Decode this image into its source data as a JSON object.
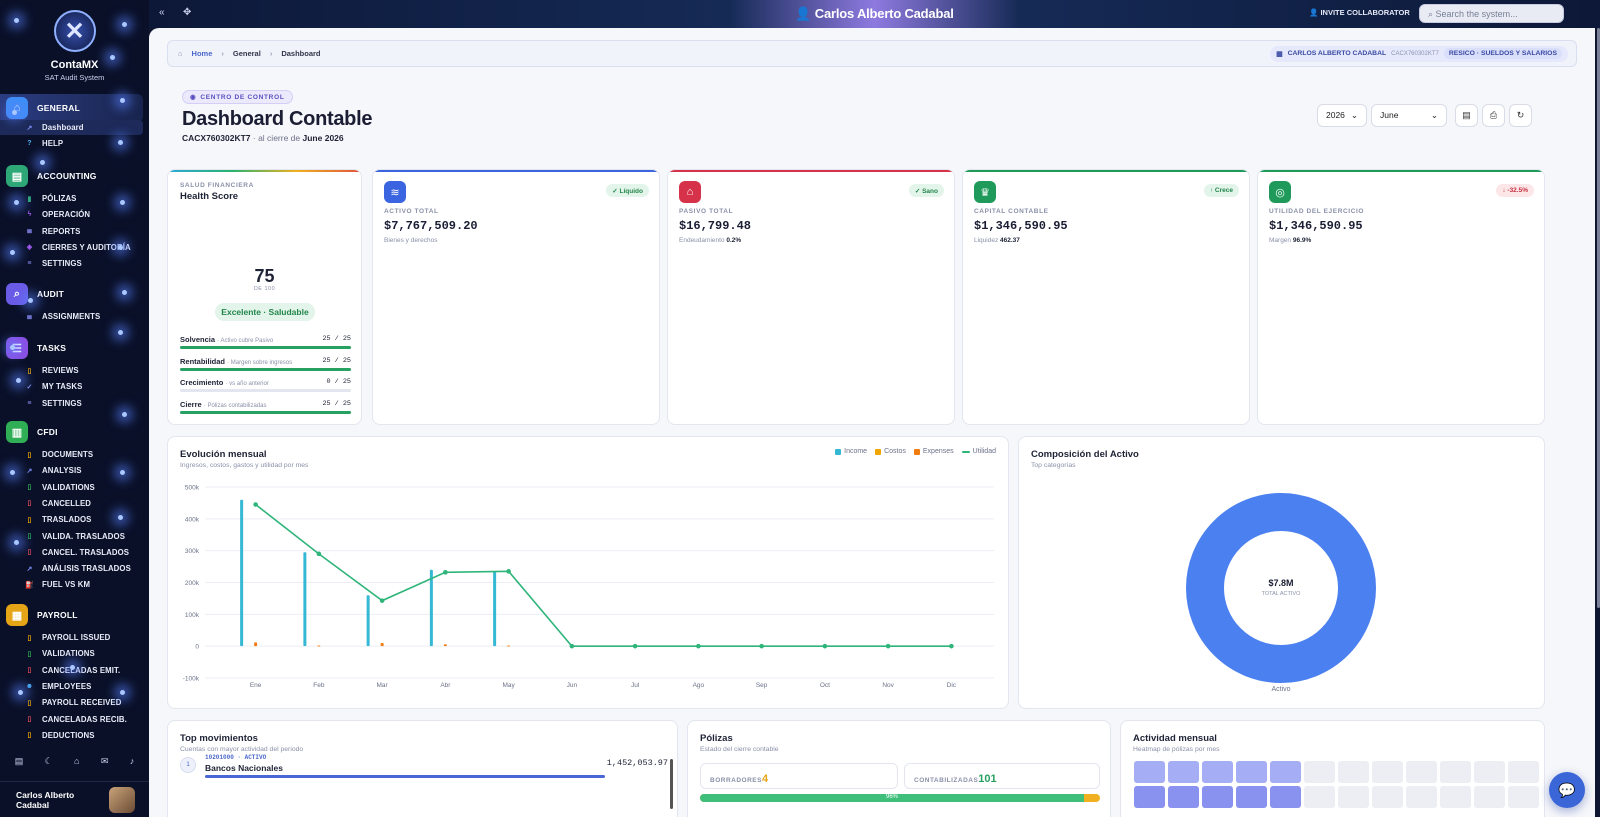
{
  "app": {
    "name": "ContaMX",
    "subtitle": "SAT Audit System",
    "user_name": "Carlos Alberto Cadabal"
  },
  "sidebar": {
    "sections": [
      {
        "label": "GENERAL",
        "icon": "home-icon",
        "color": "#3f8ef7",
        "items": [
          {
            "label": "Dashboard",
            "icon": "chart-line-icon",
            "active": true
          },
          {
            "label": "HELP",
            "icon": "question-icon"
          }
        ]
      },
      {
        "label": "ACCOUNTING",
        "icon": "ledger-icon",
        "color": "#2fa877",
        "items": [
          {
            "label": "PÓLIZAS",
            "icon": "book-icon"
          },
          {
            "label": "OPERACIÓN",
            "icon": "bolt-icon"
          },
          {
            "label": "REPORTS",
            "icon": "list-icon"
          },
          {
            "label": "CIERRES Y AUDITORÍA",
            "icon": "shield-icon"
          },
          {
            "label": "SETTINGS",
            "icon": "sliders-icon"
          }
        ]
      },
      {
        "label": "AUDIT",
        "icon": "search-icon",
        "color": "#6b5ce7",
        "items": [
          {
            "label": "ASSIGNMENTS",
            "icon": "list-icon"
          }
        ]
      },
      {
        "label": "TASKS",
        "icon": "tasks-icon",
        "color": "#8b4ee3",
        "items": [
          {
            "label": "REVIEWS",
            "icon": "doc-icon"
          },
          {
            "label": "MY TASKS",
            "icon": "check-icon"
          },
          {
            "label": "SETTINGS",
            "icon": "sliders-icon"
          }
        ]
      },
      {
        "label": "CFDI",
        "icon": "invoice-icon",
        "color": "#2fae55",
        "items": [
          {
            "label": "DOCUMENTS",
            "icon": "doc-icon"
          },
          {
            "label": "ANALYSIS",
            "icon": "chart-line-icon"
          },
          {
            "label": "VALIDATIONS",
            "icon": "check-doc-icon"
          },
          {
            "label": "CANCELLED",
            "icon": "x-doc-icon"
          },
          {
            "label": "TRASLADOS",
            "icon": "doc-icon"
          },
          {
            "label": "VALIDA. TRASLADOS",
            "icon": "check-doc-icon"
          },
          {
            "label": "CANCEL. TRASLADOS",
            "icon": "x-doc-icon"
          },
          {
            "label": "ANÁLISIS TRASLADOS",
            "icon": "chart-line-icon"
          },
          {
            "label": "FUEL VS KM",
            "icon": "fuel-icon"
          }
        ]
      },
      {
        "label": "PAYROLL",
        "icon": "payroll-icon",
        "color": "#e6a417",
        "items": [
          {
            "label": "PAYROLL ISSUED",
            "icon": "doc-icon"
          },
          {
            "label": "VALIDATIONS",
            "icon": "check-doc-icon"
          },
          {
            "label": "CANCELADAS EMIT.",
            "icon": "x-doc-icon"
          },
          {
            "label": "EMPLOYEES",
            "icon": "users-icon"
          },
          {
            "label": "PAYROLL RECEIVED",
            "icon": "doc-icon"
          },
          {
            "label": "CANCELADAS RECIB.",
            "icon": "x-doc-icon"
          },
          {
            "label": "DEDUCTIONS",
            "icon": "doc-icon"
          }
        ]
      }
    ]
  },
  "topbar": {
    "title": "Carlos Alberto Cadabal",
    "invite_label": "INVITE COLLABORATOR",
    "search_placeholder": "Search the system..."
  },
  "breadcrumb": {
    "home": "Home",
    "section": "General",
    "page": "Dashboard",
    "company": "CARLOS ALBERTO CADABAL",
    "rfc": "CACX760302KT7",
    "regime": "RESICO · SUELDOS Y SALARIOS"
  },
  "header": {
    "chip": "CENTRO DE CONTROL",
    "title": "Dashboard Contable",
    "rfc": "CACX760302KT7",
    "period_prefix": "· al cierre de",
    "period": "June 2026",
    "year": "2026",
    "month": "June"
  },
  "health": {
    "label": "SALUD FINANCIERA",
    "title": "Health Score",
    "score": "75",
    "of": "DE 100",
    "status": "Excelente · Saludable",
    "rows": [
      {
        "name": "Solvencia",
        "hint": "· Activo cubre Pasivo",
        "score": "25 / 25",
        "pct": 1
      },
      {
        "name": "Rentabilidad",
        "hint": "· Margen sobre ingresos",
        "score": "25 / 25",
        "pct": 1
      },
      {
        "name": "Crecimiento",
        "hint": "· vs año anterior",
        "score": "0 / 25",
        "pct": 0
      },
      {
        "name": "Cierre",
        "hint": "· Pólizas contabilizadas",
        "score": "25 / 25",
        "pct": 1
      }
    ]
  },
  "kpis": [
    {
      "label": "ACTIVO TOTAL",
      "value": "$7,767,509.20",
      "note": "Bienes y derechos",
      "note_value": "",
      "badge": "✓ Líquido",
      "icon": "stack-icon",
      "color": "#3a64e0",
      "badge_bg": "#e3f4ea",
      "badge_fg": "#21864a"
    },
    {
      "label": "PASIVO TOTAL",
      "value": "$16,799.48",
      "note": "Endeudamiento",
      "note_value": "0.2%",
      "badge": "✓ Sano",
      "icon": "bank-icon",
      "color": "#d6334a",
      "badge_bg": "#e3f4ea",
      "badge_fg": "#21864a"
    },
    {
      "label": "CAPITAL CONTABLE",
      "value": "$1,346,590.95",
      "note": "Liquidez",
      "note_value": "462.37",
      "badge": "↑ Crece",
      "icon": "crown-icon",
      "color": "#1f9a5a",
      "badge_bg": "#e3f4ea",
      "badge_fg": "#21864a"
    },
    {
      "label": "UTILIDAD DEL EJERCICIO",
      "value": "$1,346,590.95",
      "note": "Margen",
      "note_value": "96.9%",
      "badge": "↓ -32.5%",
      "icon": "target-icon",
      "color": "#1f9a5a",
      "badge_bg": "#fde6e8",
      "badge_fg": "#c53040"
    }
  ],
  "evolution": {
    "title": "Evolución mensual",
    "subtitle": "Ingresos, costos, gastos y utilidad por mes"
  },
  "composition": {
    "title": "Composición del Activo",
    "subtitle": "Top categorías",
    "center_value": "$7.8M",
    "center_label": "TOTAL ACTIVO",
    "slice_label": "Activo"
  },
  "chart_data": [
    {
      "type": "bar",
      "title": "Evolución mensual",
      "categories": [
        "Ene",
        "Feb",
        "Mar",
        "Abr",
        "May",
        "Jun",
        "Jul",
        "Ago",
        "Sep",
        "Oct",
        "Nov",
        "Dic"
      ],
      "y_ticks": [
        "500k",
        "400k",
        "300k",
        "200k",
        "100k",
        "0",
        "-100k"
      ],
      "ylim": [
        -100000,
        500000
      ],
      "legend_position": "top-right",
      "series": [
        {
          "name": "Income",
          "type": "bar",
          "color": "#35b8d4",
          "values": [
            460000,
            295000,
            160000,
            240000,
            235000,
            0,
            0,
            0,
            0,
            0,
            0,
            0
          ]
        },
        {
          "name": "Costos",
          "type": "bar",
          "color": "#f0a500",
          "values": [
            0,
            0,
            0,
            0,
            0,
            0,
            0,
            0,
            0,
            0,
            0,
            0
          ]
        },
        {
          "name": "Expenses",
          "type": "bar",
          "color": "#f07c10",
          "values": [
            12000,
            2000,
            10000,
            6000,
            2000,
            0,
            0,
            0,
            0,
            0,
            0,
            0
          ]
        },
        {
          "name": "Utilidad",
          "type": "line",
          "color": "#2fb57a",
          "values": [
            445000,
            290000,
            143000,
            232000,
            235000,
            0,
            0,
            0,
            0,
            0,
            0,
            0
          ]
        }
      ]
    },
    {
      "type": "pie",
      "title": "Composición del Activo",
      "categories": [
        "Activo"
      ],
      "values": [
        7767509.2
      ],
      "colors": [
        "#4b80f0"
      ]
    }
  ],
  "movements": {
    "title": "Top movimientos",
    "subtitle": "Cuentas con mayor actividad del periodo",
    "rows": [
      {
        "num": "1",
        "code": "10201000 · ACTIVO",
        "name": "Bancos Nacionales",
        "amount": "1,452,053.97"
      }
    ]
  },
  "polizas": {
    "title": "Pólizas",
    "subtitle": "Estado del cierre contable",
    "drafts_label": "BORRADORES",
    "drafts": "4",
    "posted_label": "CONTABILIZADAS",
    "posted": "101",
    "progress_label": "96%",
    "progress": 0.96
  },
  "activity": {
    "title": "Actividad mensual",
    "subtitle": "Heatmap de pólizas por mes",
    "levels": [
      2,
      2,
      2,
      2,
      2,
      0,
      0,
      0,
      0,
      0,
      0,
      0,
      3,
      3,
      3,
      3,
      3,
      0,
      0,
      0,
      0,
      0,
      0,
      0
    ]
  }
}
